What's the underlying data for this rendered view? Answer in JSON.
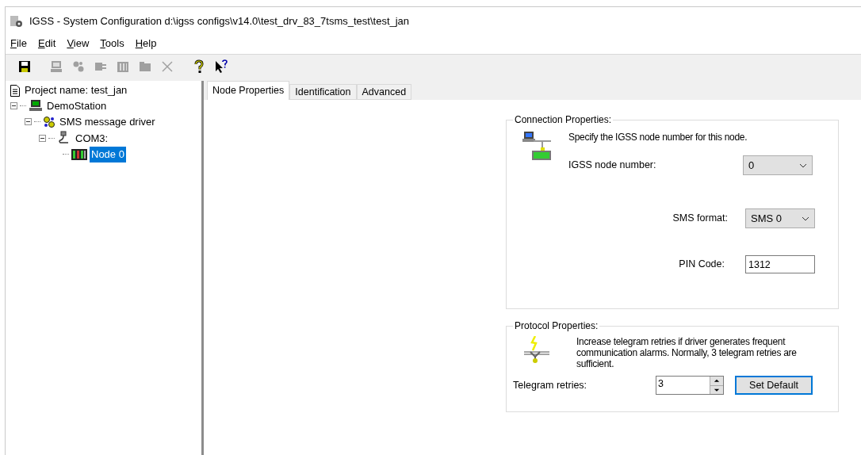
{
  "window": {
    "title": "IGSS -  System Configuration d:\\igss configs\\v14.0\\test_drv_83_7tsms_test\\test_jan"
  },
  "menu": [
    "File",
    "Edit",
    "View",
    "Tools",
    "Help"
  ],
  "toolbar": [
    {
      "kind": "save",
      "disabled": false
    },
    {
      "kind": "station",
      "disabled": true
    },
    {
      "kind": "driver",
      "disabled": true
    },
    {
      "kind": "port",
      "disabled": true
    },
    {
      "kind": "node",
      "disabled": true
    },
    {
      "kind": "folder",
      "disabled": true
    },
    {
      "kind": "delete",
      "disabled": true
    },
    {
      "kind": "help",
      "disabled": false
    },
    {
      "kind": "context-help",
      "disabled": false
    }
  ],
  "tree": {
    "label": "Project name: test_jan",
    "children": [
      {
        "label": "DemoStation",
        "kind": "station",
        "expanded": true,
        "selected": false,
        "children": [
          {
            "label": "SMS message driver",
            "kind": "driver",
            "expanded": true,
            "selected": false,
            "children": [
              {
                "label": "COM3:",
                "kind": "port",
                "expanded": true,
                "selected": false,
                "children": [
                  {
                    "label": "Node 0",
                    "kind": "node",
                    "selected": true
                  }
                ]
              }
            ]
          }
        ]
      }
    ]
  },
  "tabs": [
    {
      "label": "Node Properties",
      "selected": true
    },
    {
      "label": "Identification",
      "selected": false
    },
    {
      "label": "Advanced",
      "selected": false
    }
  ],
  "connection": {
    "title": "Connection Properties:",
    "description": "Specify the IGSS node number for this node.",
    "node_number": {
      "label": "IGSS node number:",
      "value": "0"
    },
    "sms_format": {
      "label": "SMS format:",
      "value": "SMS 0"
    },
    "pin_code": {
      "label": "PIN Code:",
      "value": "1312"
    }
  },
  "protocol": {
    "title": "Protocol Properties:",
    "description": "Increase telegram retries if driver generates frequent communication alarms. Normally, 3 telegram retries are sufficient.",
    "retries": {
      "label": "Telegram retries:",
      "value": "3"
    },
    "button": "Set Default"
  }
}
